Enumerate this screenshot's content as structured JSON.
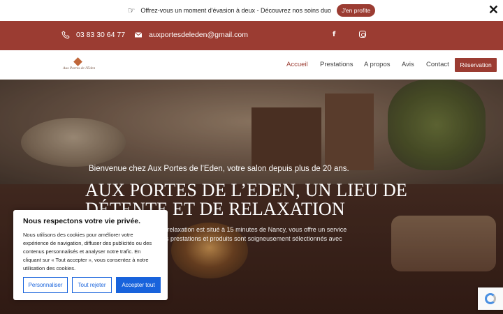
{
  "promo": {
    "text": "Offrez-vous un moment d'évasion à deux - Découvrez nos soins duo",
    "button": "J'en profite",
    "close": "✕",
    "icon": "hand-pointing-icon"
  },
  "topbar": {
    "phone": "03 83 30 64 77",
    "email": "auxportesdeleden@gmail.com",
    "facebook": "f",
    "background": "#9b3c32"
  },
  "nav": {
    "logo_text": "Aux Portes de l'Eden",
    "items": [
      "Accueil",
      "Prestations",
      "A propos",
      "Avis",
      "Contact"
    ],
    "active": "Accueil",
    "reservation": "Réservation"
  },
  "hero": {
    "welcome": "Bienvenue chez Aux Portes de l’Eden, votre salon depuis plus de 20 ans.",
    "title_line1": "AUX PORTES DE L’EDEN, UN LIEU DE",
    "title_line2": "DÉTENTE ET DE RELAXATION",
    "desc_line1": "e relaxation est situé à 15 minutes de Nancy, vous offre un service",
    "desc_line2": "os prestations et produits sont soigneusement sélectionnés avec"
  },
  "cookie": {
    "title": "Nous respectons votre vie privée.",
    "text": "Nous utilisons des cookies pour améliorer votre expérience de navigation, diffuser des publicités ou des contenus personnalisés et analyser notre trafic. En cliquant sur « Tout accepter », vous consentez à notre utilisation des cookies.",
    "customize": "Personnaliser",
    "reject": "Tout rejeter",
    "accept": "Accepter tout"
  },
  "colors": {
    "brand": "#9b3c32",
    "cookie_button": "#1863dc"
  }
}
